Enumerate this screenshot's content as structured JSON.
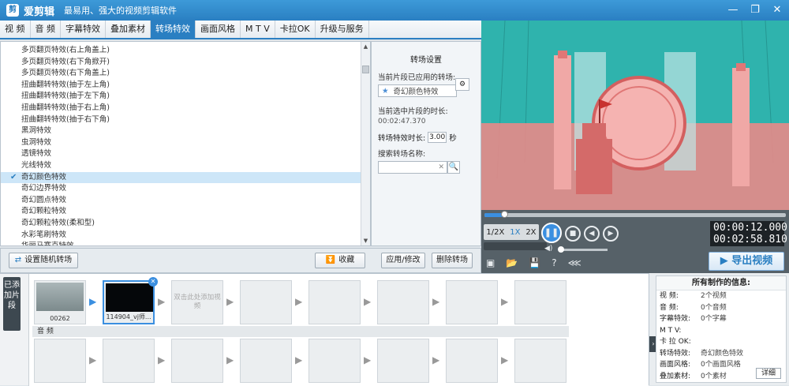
{
  "app": {
    "logo_glyph": "剪",
    "name": "爱剪辑",
    "slogan": "最易用、强大的视频剪辑软件",
    "window_buttons": [
      "—",
      "❐",
      "✕"
    ]
  },
  "tabs": [
    "视 频",
    "音 频",
    "字幕特效",
    "叠加素材",
    "转场特效",
    "画面风格",
    "M T V",
    "卡拉OK",
    "升级与服务"
  ],
  "active_tab": "转场特效",
  "transition_list": [
    {
      "label": "多页翻页特效(右上角盖上)",
      "selected": false
    },
    {
      "label": "多页翻页特效(右下角掀开)",
      "selected": false
    },
    {
      "label": "多页翻页特效(右下角盖上)",
      "selected": false
    },
    {
      "label": "扭曲翻转特效(抽于左上角)",
      "selected": false
    },
    {
      "label": "扭曲翻转特效(抽于左下角)",
      "selected": false
    },
    {
      "label": "扭曲翻转特效(抽于右上角)",
      "selected": false
    },
    {
      "label": "扭曲翻转特效(抽于右下角)",
      "selected": false
    },
    {
      "label": "黑洞特效",
      "selected": false
    },
    {
      "label": "虫洞特效",
      "selected": false
    },
    {
      "label": "透镜特效",
      "selected": false
    },
    {
      "label": "光线特效",
      "selected": false
    },
    {
      "label": "奇幻颜色特效",
      "selected": true
    },
    {
      "label": "奇幻边界特效",
      "selected": false
    },
    {
      "label": "奇幻圆点特效",
      "selected": false
    },
    {
      "label": "奇幻颗粒特效",
      "selected": false
    },
    {
      "label": "奇幻颗粒特效(柔和型)",
      "selected": false
    },
    {
      "label": "水彩笔刷特效",
      "selected": false
    },
    {
      "label": "华丽马赛克特效",
      "selected": false
    }
  ],
  "settings": {
    "title": "转场设置",
    "applied_label": "当前片段已应用的转场:",
    "applied_value": "奇幻颜色特效",
    "duration_label": "当前选中片段的时长:",
    "duration_value": "00:02:47.370",
    "effect_duration_label": "转场特效时长:",
    "effect_duration_value": "3.00",
    "effect_duration_unit": "秒",
    "search_label": "搜索转场名称:",
    "search_clear": "✕",
    "search_icon": "🔍"
  },
  "toolbar": {
    "random_label": "设置随机转场",
    "collect_label": "收藏",
    "apply_label": "应用/修改",
    "delete_label": "删除转场"
  },
  "player": {
    "speeds": [
      "1/2X",
      "1X",
      "2X"
    ],
    "active_speed": "1X",
    "current_time": "00:00:12.000",
    "total_time": "00:02:58.810",
    "export_label": "导出视频",
    "export_icon": "▶",
    "progress": 0.065,
    "play_glyph": "❚❚",
    "stop_glyph": "■",
    "prev_glyph": "◀",
    "next_glyph": "▶",
    "vol_glyph": "◀)",
    "icons": [
      "▣",
      "📂",
      "💾",
      "?",
      "⋘"
    ]
  },
  "timeline": {
    "side_tab": "已添加片段",
    "clips": [
      {
        "caption": "00262",
        "kind": "img"
      },
      {
        "caption": "114904_vj师...",
        "kind": "black",
        "close": "✕"
      }
    ],
    "placeholder_hint": "双击此处添加视频",
    "audio_label": "音 频",
    "arrow_glyph": "▶"
  },
  "info": {
    "title": "所有制作的信息:",
    "rows": [
      {
        "k": "视  频:",
        "v": "2个视频"
      },
      {
        "k": "音  频:",
        "v": "0个音频"
      },
      {
        "k": "字幕特效:",
        "v": "0个字幕"
      },
      {
        "k": "M T V:",
        "v": ""
      },
      {
        "k": "卡 拉 OK:",
        "v": ""
      },
      {
        "k": "转场特效:",
        "v": "奇幻颜色特效"
      },
      {
        "k": "画面风格:",
        "v": "0个画面风格"
      },
      {
        "k": "叠加素材:",
        "v": "0个素材"
      }
    ],
    "detail_label": "详细",
    "collapse_glyph": "›"
  }
}
